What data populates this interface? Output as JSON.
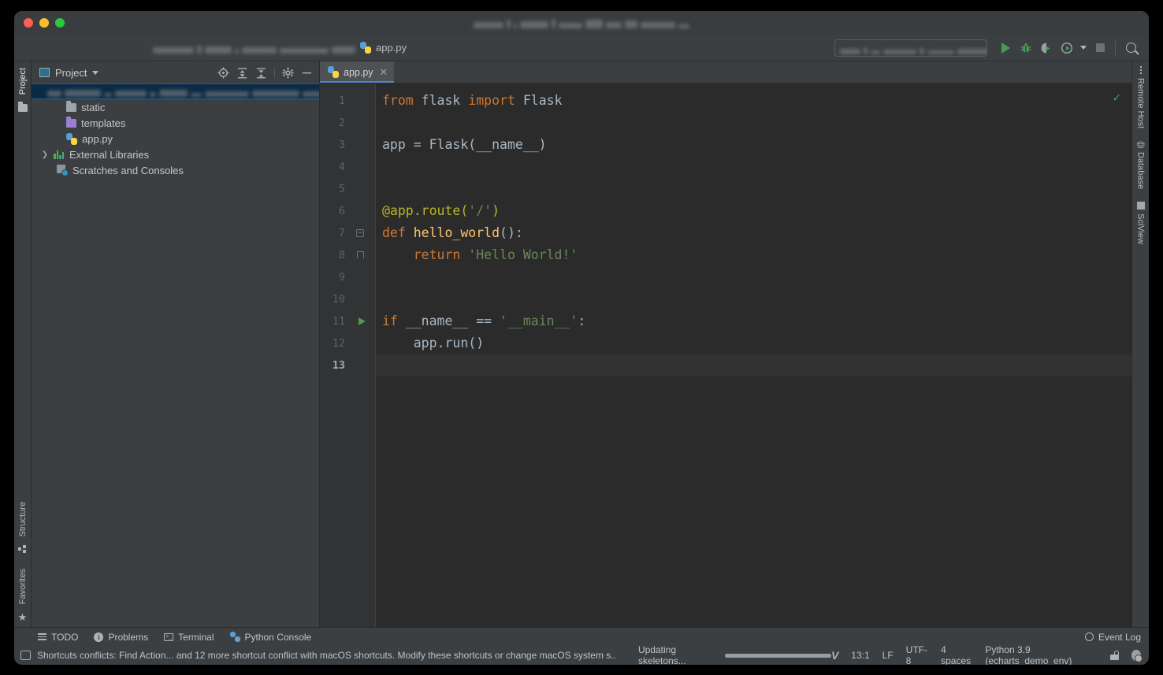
{
  "window": {
    "title_redacted": true,
    "traffic_lights": [
      "close",
      "minimize",
      "zoom"
    ]
  },
  "breadcrumb": {
    "path_redacted": true,
    "file_label": "app.py",
    "file_icon": "python-file-icon"
  },
  "toolbar": {
    "run_config_redacted": true,
    "buttons": [
      {
        "name": "run-button",
        "icon": "run-triangle-icon"
      },
      {
        "name": "debug-button",
        "icon": "bug-icon"
      },
      {
        "name": "run-coverage-button",
        "icon": "coverage-icon"
      },
      {
        "name": "profile-button",
        "icon": "profiler-icon"
      },
      {
        "name": "more-dropdown",
        "icon": "chevron-down-icon"
      },
      {
        "name": "stop-button",
        "icon": "stop-square-icon"
      },
      {
        "name": "search-everywhere-button",
        "icon": "search-icon"
      }
    ]
  },
  "left_strip": {
    "top_tabs": [
      {
        "label": "Project",
        "icon": "folder-icon",
        "active": true
      }
    ],
    "bottom_tabs": [
      {
        "label": "Structure",
        "icon": "structure-icon"
      },
      {
        "label": "Favorites",
        "icon": "star-icon"
      }
    ]
  },
  "project_panel": {
    "title": "Project",
    "tools": [
      {
        "name": "select-opened-file-icon"
      },
      {
        "name": "expand-all-icon"
      },
      {
        "name": "collapse-all-icon"
      },
      {
        "name": "settings-gear-icon"
      },
      {
        "name": "hide-panel-icon"
      }
    ],
    "tree": [
      {
        "label": "",
        "redacted": true,
        "depth": 0,
        "icon": "folder-icon",
        "selected": true,
        "chevron": "expanded"
      },
      {
        "label": "static",
        "depth": 1,
        "icon": "folder-gray-icon"
      },
      {
        "label": "templates",
        "depth": 1,
        "icon": "folder-purple-icon"
      },
      {
        "label": "app.py",
        "depth": 1,
        "icon": "python-file-icon"
      },
      {
        "label": "External Libraries",
        "depth": 0,
        "icon": "library-icon",
        "chevron": "collapsed"
      },
      {
        "label": "Scratches and Consoles",
        "depth": 0,
        "icon": "scratches-icon"
      }
    ]
  },
  "editor": {
    "tabs": [
      {
        "label": "app.py",
        "icon": "python-file-icon",
        "active": true,
        "closable": true
      }
    ],
    "inspection_status": "ok",
    "current_line": 13,
    "lines": [
      {
        "n": 1,
        "tokens": [
          {
            "t": "from ",
            "c": "kw"
          },
          {
            "t": "flask ",
            "c": "txt"
          },
          {
            "t": "import ",
            "c": "kw"
          },
          {
            "t": "Flask",
            "c": "cls"
          }
        ]
      },
      {
        "n": 2,
        "tokens": []
      },
      {
        "n": 3,
        "tokens": [
          {
            "t": "app = Flask(__name__)",
            "c": "txt"
          }
        ]
      },
      {
        "n": 4,
        "tokens": []
      },
      {
        "n": 5,
        "tokens": []
      },
      {
        "n": 6,
        "tokens": [
          {
            "t": "@app.route(",
            "c": "dec"
          },
          {
            "t": "'/'",
            "c": "str"
          },
          {
            "t": ")",
            "c": "dec"
          }
        ],
        "gutter_icon": "none"
      },
      {
        "n": 7,
        "tokens": [
          {
            "t": "def ",
            "c": "kw"
          },
          {
            "t": "hello_world",
            "c": "fn"
          },
          {
            "t": "():",
            "c": "txt"
          }
        ],
        "gutter_icon": "fold-start"
      },
      {
        "n": 8,
        "tokens": [
          {
            "t": "    return ",
            "c": "kw"
          },
          {
            "t": "'Hello World!'",
            "c": "str"
          }
        ],
        "gutter_icon": "fold-end"
      },
      {
        "n": 9,
        "tokens": []
      },
      {
        "n": 10,
        "tokens": []
      },
      {
        "n": 11,
        "tokens": [
          {
            "t": "if ",
            "c": "kw"
          },
          {
            "t": "__name__ == ",
            "c": "txt"
          },
          {
            "t": "'__main__'",
            "c": "str"
          },
          {
            "t": ":",
            "c": "txt"
          }
        ],
        "gutter_icon": "run-arrow"
      },
      {
        "n": 12,
        "tokens": [
          {
            "t": "    app.run()",
            "c": "txt"
          }
        ]
      },
      {
        "n": 13,
        "tokens": [],
        "current": true
      }
    ]
  },
  "right_strip": {
    "tabs": [
      {
        "label": "Remote Host",
        "icon": "remote-host-icon"
      },
      {
        "label": "Database",
        "icon": "database-icon"
      },
      {
        "label": "SciView",
        "icon": "sciview-grid-icon"
      }
    ]
  },
  "bottom_tool_bar": {
    "items": [
      {
        "label": "TODO",
        "icon": "todo-list-icon"
      },
      {
        "label": "Problems",
        "icon": "problems-info-icon"
      },
      {
        "label": "Terminal",
        "icon": "terminal-icon"
      },
      {
        "label": "Python Console",
        "icon": "python-console-icon"
      }
    ],
    "event_log": {
      "label": "Event Log",
      "icon": "event-log-icon"
    }
  },
  "status_bar": {
    "message": "Shortcuts conflicts: Find Action... and 12 more shortcut conflict with macOS shortcuts. Modify these shortcuts or change macOS system s..",
    "message_icon": "notification-icon",
    "progress_label": "Updating skeletons...",
    "progress_percent": 100,
    "vcs_icon": "vcs-branch-icon",
    "caret_position": "13:1",
    "line_separator": "LF",
    "encoding": "UTF-8",
    "indent": "4 spaces",
    "interpreter": "Python 3.9 (echarts_demo_env)",
    "lock_icon": "unlocked-icon",
    "settings_icon": "ide-settings-icon"
  },
  "colors": {
    "window_chrome": "#3c3f41",
    "editor_bg": "#2b2b2b",
    "gutter_bg": "#313335",
    "accent_blue": "#4a88c7",
    "keyword": "#cc7832",
    "string": "#6a8759",
    "function": "#ffc66d",
    "decorator": "#bbb529",
    "default_text": "#a9b7c6",
    "run_green": "#499c54",
    "selection": "#0d2a44"
  }
}
